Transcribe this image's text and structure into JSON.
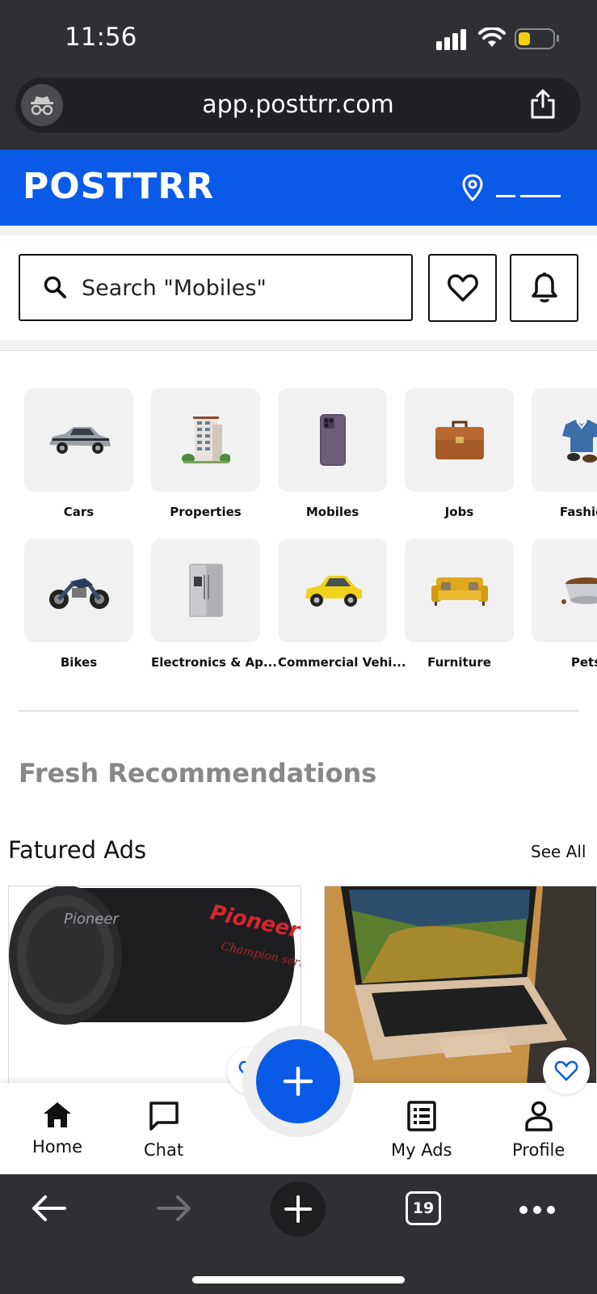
{
  "status_bar": {
    "time": "11:56"
  },
  "browser": {
    "url": "app.posttrr.com",
    "tab_count": "19"
  },
  "header": {
    "logo": "POSTTRR",
    "location": ""
  },
  "search": {
    "placeholder": "Search \"Mobiles\""
  },
  "categories": [
    {
      "label": "Cars",
      "icon": "car-icon"
    },
    {
      "label": "Properties",
      "icon": "building-icon"
    },
    {
      "label": "Mobiles",
      "icon": "phone-icon"
    },
    {
      "label": "Jobs",
      "icon": "briefcase-icon"
    },
    {
      "label": "Fashion",
      "icon": "shirt-icon"
    },
    {
      "label": "Bikes",
      "icon": "motorbike-icon"
    },
    {
      "label": "Electronics & Ap...",
      "icon": "fridge-icon"
    },
    {
      "label": "Commercial Vehi...",
      "icon": "taxi-icon"
    },
    {
      "label": "Furniture",
      "icon": "sofa-icon"
    },
    {
      "label": "Pets",
      "icon": "pet-bowl-icon"
    }
  ],
  "sections": {
    "fresh_title": "Fresh Recommendations",
    "featured_title": "Fatured Ads",
    "see_all": "See All"
  },
  "ads": [
    {
      "image": "subwoofer-image",
      "brand_text": "Pioneer"
    },
    {
      "image": "laptop-image"
    }
  ],
  "bottom_nav": {
    "home": "Home",
    "chat": "Chat",
    "my_ads": "My Ads",
    "profile": "Profile"
  },
  "colors": {
    "brand": "#0a5ae8",
    "chrome": "#2f3033"
  }
}
